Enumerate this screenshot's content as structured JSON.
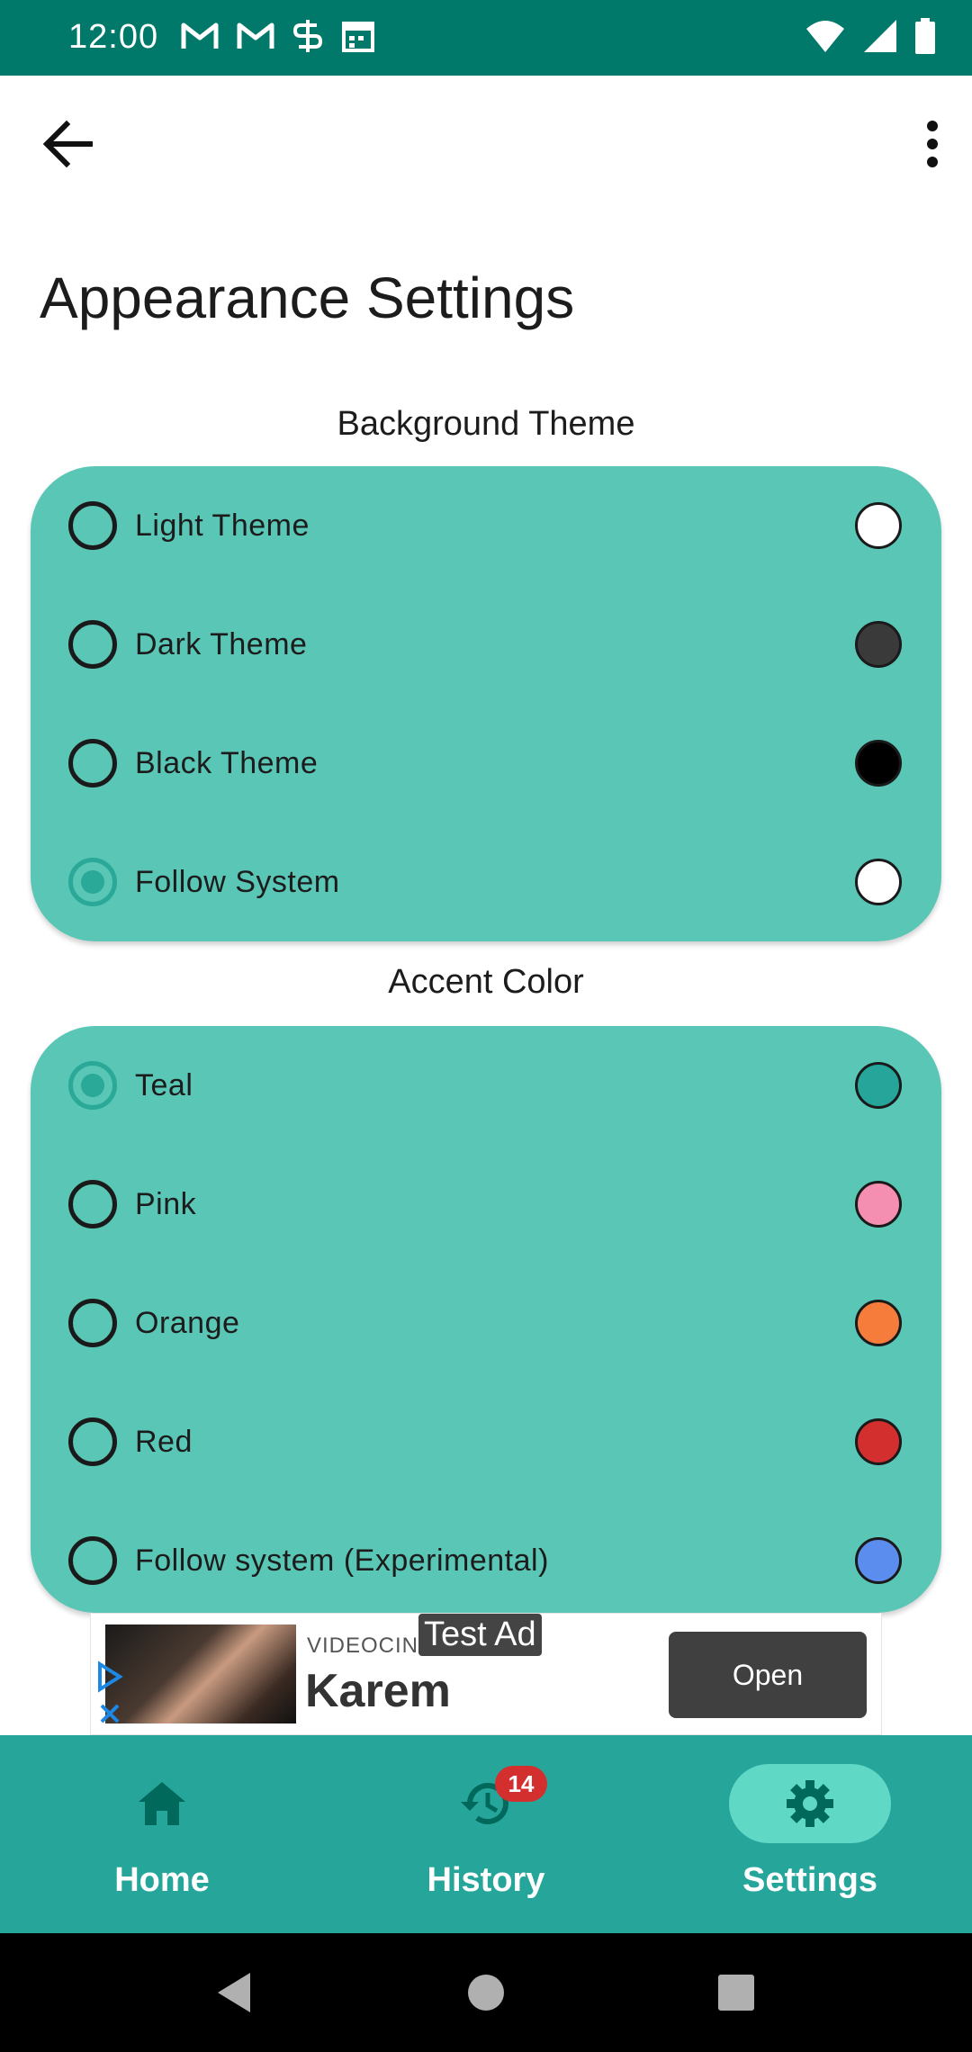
{
  "status_bar": {
    "time": "12:00",
    "left_icons": [
      "gmail-icon",
      "gmail-icon",
      "sync-icon",
      "calendar-icon"
    ],
    "right_icons": [
      "wifi-icon",
      "signal-icon",
      "battery-icon"
    ]
  },
  "app_bar": {
    "back_icon": "arrow-back-icon",
    "menu_icon": "more-vert-icon"
  },
  "page": {
    "title": "Appearance Settings"
  },
  "background_theme": {
    "label": "Background Theme",
    "options": [
      {
        "label": "Light Theme",
        "selected": false,
        "swatch": "#ffffff"
      },
      {
        "label": "Dark Theme",
        "selected": false,
        "swatch": "#3a3a3a"
      },
      {
        "label": "Black Theme",
        "selected": false,
        "swatch": "#000000"
      },
      {
        "label": "Follow System",
        "selected": true,
        "swatch": "#ffffff"
      }
    ]
  },
  "accent_color": {
    "label": "Accent Color",
    "options": [
      {
        "label": "Teal",
        "selected": true,
        "swatch": "#26a69a"
      },
      {
        "label": "Pink",
        "selected": false,
        "swatch": "#f48fb1"
      },
      {
        "label": "Orange",
        "selected": false,
        "swatch": "#f57c3a"
      },
      {
        "label": "Red",
        "selected": false,
        "swatch": "#d32f2f"
      },
      {
        "label": "Follow system (Experimental)",
        "selected": false,
        "swatch": "#5b8def"
      }
    ]
  },
  "ad": {
    "brand": "VIDEOCINE",
    "title": "Karem",
    "tag": "Test Ad",
    "open_label": "Open"
  },
  "bottom_nav": {
    "items": [
      {
        "label": "Home",
        "icon": "home-icon",
        "active": false
      },
      {
        "label": "History",
        "icon": "history-icon",
        "active": false,
        "badge": "14"
      },
      {
        "label": "Settings",
        "icon": "settings-gear-icon",
        "active": true
      }
    ]
  },
  "colors": {
    "status_bar": "#00796b",
    "card": "#5ac6b6",
    "bottom_nav": "#26a69a",
    "nav_active_pill": "#5fd8c6",
    "radio_checked": "#2aa898"
  }
}
